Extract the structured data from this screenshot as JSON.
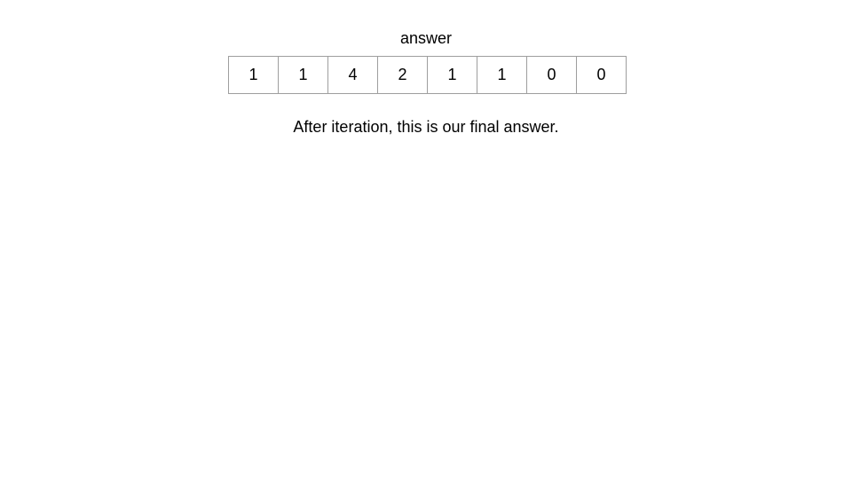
{
  "array": {
    "label": "answer",
    "values": [
      "1",
      "1",
      "4",
      "2",
      "1",
      "1",
      "0",
      "0"
    ]
  },
  "caption": "After iteration, this is our final answer."
}
